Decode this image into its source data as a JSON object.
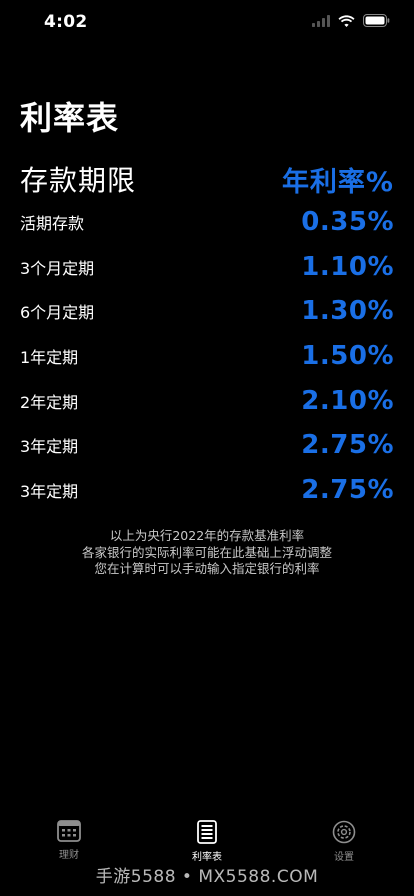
{
  "status_bar": {
    "time": "4:02"
  },
  "page": {
    "title": "利率表"
  },
  "table": {
    "term_header": "存款期限",
    "rate_header": "年利率%",
    "rows": [
      {
        "term": "活期存款",
        "rate": "0.35%"
      },
      {
        "term": "3个月定期",
        "rate": "1.10%"
      },
      {
        "term": "6个月定期",
        "rate": "1.30%"
      },
      {
        "term": "1年定期",
        "rate": "1.50%"
      },
      {
        "term": "2年定期",
        "rate": "2.10%"
      },
      {
        "term": "3年定期",
        "rate": "2.75%"
      },
      {
        "term": "3年定期",
        "rate": "2.75%"
      }
    ]
  },
  "notes": [
    "以上为央行2022年的存款基准利率",
    "各家银行的实际利率可能在此基础上浮动调整",
    "您在计算时可以手动输入指定银行的利率"
  ],
  "tabs": [
    {
      "label": "理财",
      "icon": "calculator-icon",
      "active": false
    },
    {
      "label": "利率表",
      "icon": "document-list-icon",
      "active": true
    },
    {
      "label": "设置",
      "icon": "gear-icon",
      "active": false
    }
  ],
  "watermark": "手游5588 • MX5588.COM",
  "colors": {
    "accent": "#1a6fe6",
    "background": "#000000",
    "text": "#ffffff",
    "tab_inactive": "#8e8e8e"
  }
}
